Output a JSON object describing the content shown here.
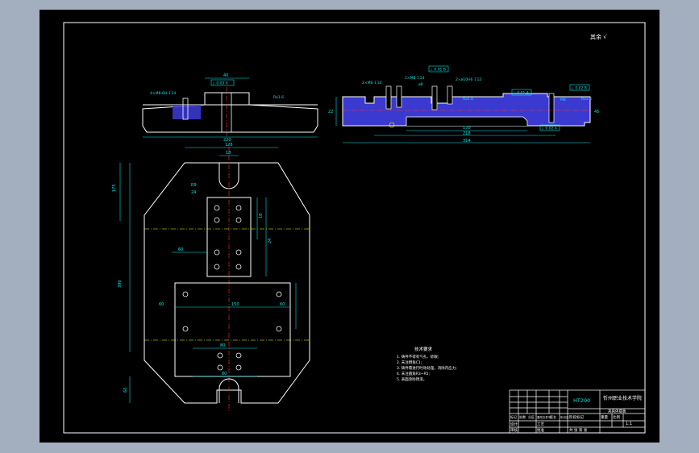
{
  "header": {
    "roughness_note": "其余 √"
  },
  "material": "HT200",
  "title_block": {
    "school": "忻州职业技术学院",
    "drawing_name": "夹具体底板",
    "row_labels": [
      "标记",
      "处数",
      "分区",
      "更改文件号",
      "签名",
      "年月日"
    ],
    "design_label": "设计",
    "review_label": "审核",
    "process_label": "工艺",
    "approve_label": "批准",
    "stage_label": "阶段标记",
    "weight_label": "重量",
    "scale_label": "比例",
    "scale_value": "1:1",
    "sheet_label": "共 张 第 张"
  },
  "tech_requirements": {
    "title": "技术要求",
    "items": [
      "1. 铸件不得有气孔、砂眼;",
      "2. 未注倒角C1;",
      "3. 铸件需进行时效处理，消除内应力;",
      "4. 未注圆角R3~R5;",
      "5. 表面涂防锈漆。"
    ]
  },
  "front_view": {
    "dims": {
      "width_top": "40",
      "fit": "⊥ 0.03 A",
      "threads": "4×M8-6H ↧14",
      "ra_right": "Ra1.6",
      "overall": "220"
    }
  },
  "side_view": {
    "dims": {
      "thread_left": "2×M8 ↧14",
      "thread_mid": "2×M8 ↧14",
      "tol_top": "⊥ 0.01 B",
      "hole_small": "ø8",
      "hole_h6": "2×ø10H6 ↧12",
      "tol_mid": "⊥ 0.01 A",
      "tol_right": "⊥ 0.02 B",
      "ra_left": "Ra1.6",
      "ra_right": "Ra1.6",
      "depth": "M8",
      "height": "22",
      "len_inner": "170",
      "len_mid": "218",
      "len_total": "314",
      "datum": "⊥ 0.02 A",
      "height_right": "45"
    }
  },
  "plan_view": {
    "dims": {
      "top_width": "128",
      "slot_width": "18",
      "slot_r": "R9",
      "slot_depth": "24",
      "left_height_top": "175",
      "left_height_mid": "390",
      "left_height_bottom": "60",
      "pattern_dim1": "18",
      "pattern_dim2": "24",
      "mid_width": "60",
      "lower_width": "150",
      "lower_left": "60",
      "lower_right": "60",
      "holes_width": "80",
      "bottom_width": "80"
    }
  }
}
